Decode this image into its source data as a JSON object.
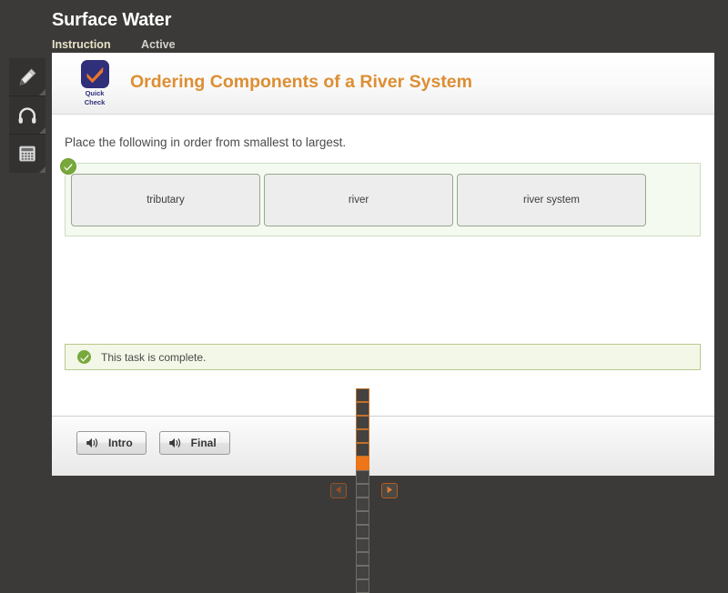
{
  "header": {
    "lesson_title": "Surface Water",
    "tabs": [
      {
        "label": "Instruction",
        "state": "active"
      },
      {
        "label": "Active",
        "state": "inactive"
      }
    ]
  },
  "toolbar": {
    "tools": [
      {
        "name": "highlighter-icon",
        "label": "Highlighter"
      },
      {
        "name": "headphones-icon",
        "label": "Audio"
      },
      {
        "name": "calculator-icon",
        "label": "Calculator"
      }
    ]
  },
  "card": {
    "logo": {
      "line1": "Quick",
      "line2": "Check"
    },
    "activity_title": "Ordering Components of a River System",
    "prompt": "Place the following in order from smallest to largest.",
    "drop_zone": {
      "status": "correct",
      "tiles": [
        {
          "label": "tributary"
        },
        {
          "label": "river"
        },
        {
          "label": "river system"
        }
      ]
    },
    "completion": {
      "message": "This task is complete."
    },
    "audio_buttons": [
      {
        "label": "Intro"
      },
      {
        "label": "Final"
      }
    ]
  },
  "pager": {
    "prev_label": "Previous",
    "next_label": "Next",
    "total_pages": 15,
    "current_page": 6,
    "visited_pages": 5
  },
  "colors": {
    "app_background": "#3b3a38",
    "title_accent": "#dd8e33",
    "pager_accent": "#ee7518",
    "success": "#78a93b",
    "tab_active": "#e8e2c8"
  }
}
